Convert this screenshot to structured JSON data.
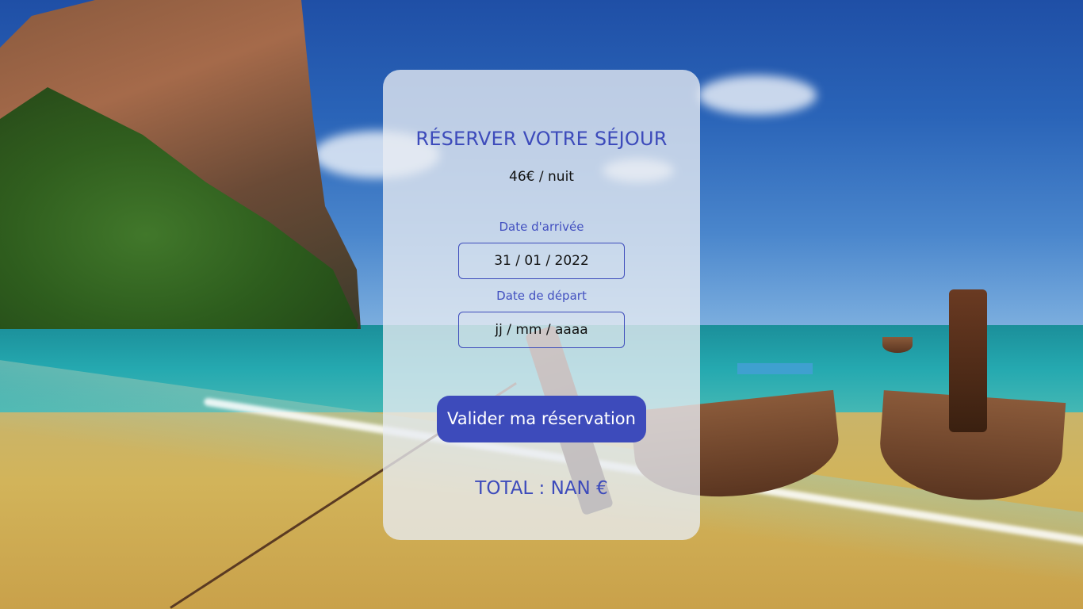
{
  "booking": {
    "title": "RÉSERVER VOTRE SÉJOUR",
    "price": "46€ / nuit",
    "arrival": {
      "label": "Date d'arrivée",
      "value": "31 / 01 / 2022"
    },
    "departure": {
      "label": "Date de départ",
      "placeholder": "jj / mm / aaaa"
    },
    "submit_label": "Valider ma réservation",
    "total": "TOTAL : NAN €"
  },
  "colors": {
    "accent": "#3d4bbb",
    "card_background": "#e8ecf2",
    "button_text": "#ffffff"
  }
}
